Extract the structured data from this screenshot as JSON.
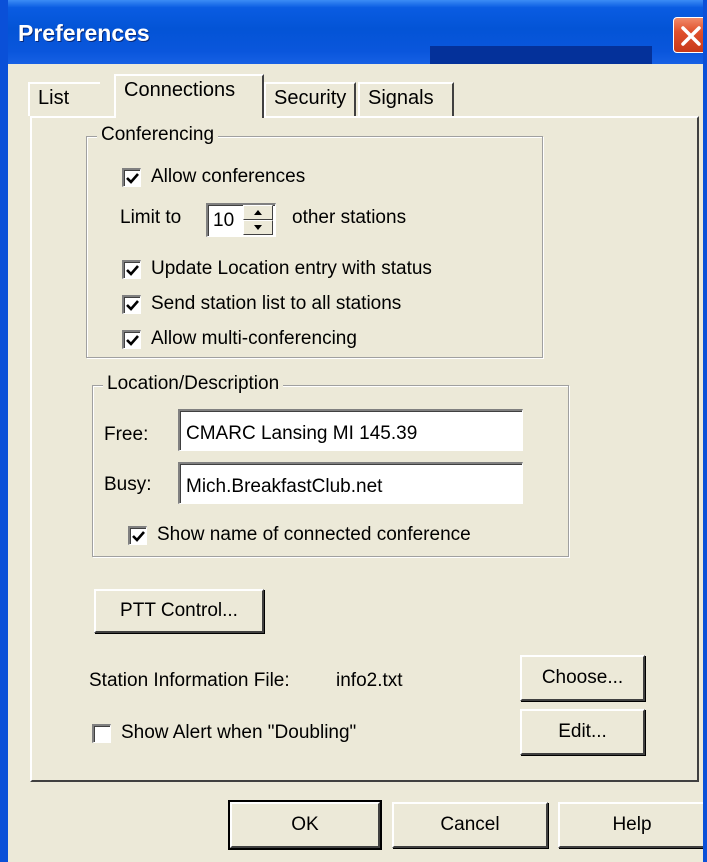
{
  "window": {
    "title": "Preferences"
  },
  "tabs": [
    {
      "label": "List",
      "active": false
    },
    {
      "label": "Connections",
      "active": true
    },
    {
      "label": "Security",
      "active": false
    },
    {
      "label": "Signals",
      "active": false
    }
  ],
  "conferencing": {
    "legend": "Conferencing",
    "allow_conferences": {
      "label": "Allow conferences",
      "checked": true
    },
    "limit_prefix": "Limit to",
    "limit_value": "10",
    "limit_suffix": "other stations",
    "update_location": {
      "label": "Update Location entry with status",
      "checked": true
    },
    "send_station_list": {
      "label": "Send station list to all stations",
      "checked": true
    },
    "multi_conferencing": {
      "label": "Allow multi-conferencing",
      "checked": true
    }
  },
  "location": {
    "legend": "Location/Description",
    "free_label": "Free:",
    "free_value": "CMARC Lansing MI 145.39",
    "busy_label": "Busy:",
    "busy_value": "Mich.BreakfastClub.net",
    "show_name": {
      "label": "Show name of connected conference",
      "checked": true
    }
  },
  "ptt_button": "PTT Control...",
  "station_info": {
    "label": "Station Information File:",
    "filename": "info2.txt",
    "choose_button": "Choose...",
    "edit_button": "Edit..."
  },
  "doubling": {
    "label": "Show Alert when \"Doubling\"",
    "checked": false
  },
  "footer": {
    "ok": "OK",
    "cancel": "Cancel",
    "help": "Help"
  }
}
